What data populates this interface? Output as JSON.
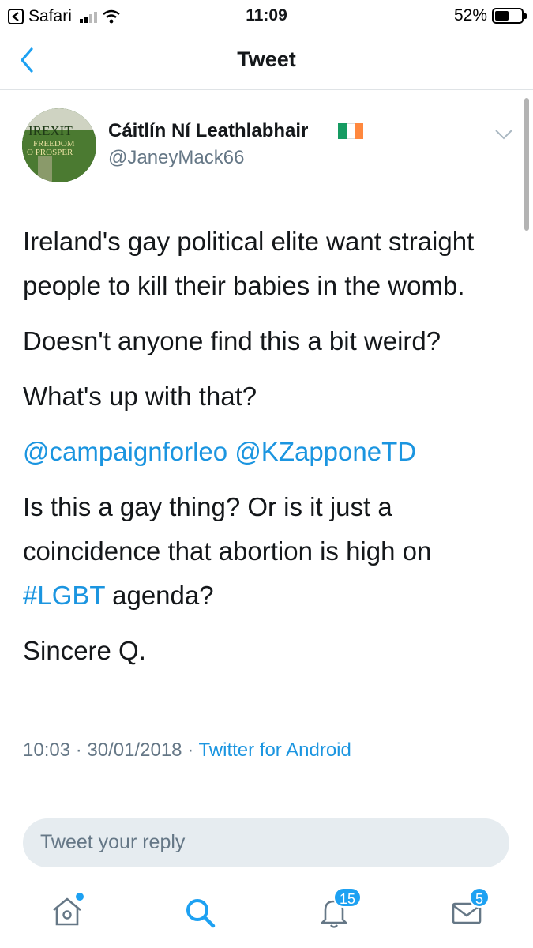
{
  "status_bar": {
    "back_app": "Safari",
    "time": "11:09",
    "battery": "52%",
    "battery_level": 0.52
  },
  "nav": {
    "title": "Tweet"
  },
  "tweet": {
    "display_name": "Cáitlín Ní Leathlabhair",
    "username": "@JaneyMack66",
    "avatar_lines": [
      "IREXIT",
      "FREEDOM",
      "O PROSPER"
    ],
    "paragraphs": {
      "p1": "Ireland's gay political elite want straight people to kill their babies in the womb.",
      "p2": "Doesn't anyone find this a bit weird?",
      "p3": "What's up with that?",
      "mention1": "@campaignforleo",
      "mention2": "@KZapponeTD",
      "p5a": "Is this a gay thing? Or is it just a coincidence that abortion is high on",
      "hashtag": "#LGBT",
      "p5b": "agenda?",
      "p6": "Sincere Q."
    },
    "time": "10:03",
    "date": "30/01/2018",
    "client": "Twitter for Android"
  },
  "reply": {
    "placeholder": "Tweet your reply"
  },
  "tab_bar": {
    "notifications_badge": "15",
    "messages_badge": "5"
  },
  "colors": {
    "link": "#1b95e0",
    "badge": "#1da1f2",
    "flag": [
      "#169b62",
      "#ffffff",
      "#ff883e"
    ]
  }
}
